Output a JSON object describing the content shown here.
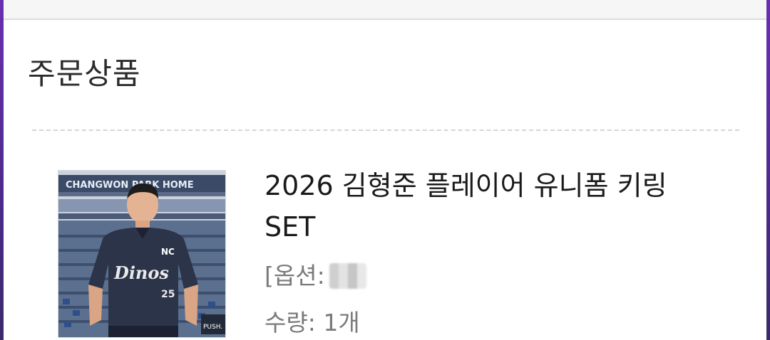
{
  "header": {
    "title": "주문상품"
  },
  "order_item": {
    "product_name_line1": "2026 김형준 플레이어 유니폼 키링",
    "product_name_line2": "SET",
    "option_label": "[옵션:",
    "quantity_text": "수량: 1개",
    "image_texts": {
      "stadium_sign": "CHANGWON PARK HOME",
      "jersey_brand": "Dinos",
      "jersey_logo": "NC",
      "jersey_number": "25",
      "corner_sign": "PUSH."
    }
  }
}
